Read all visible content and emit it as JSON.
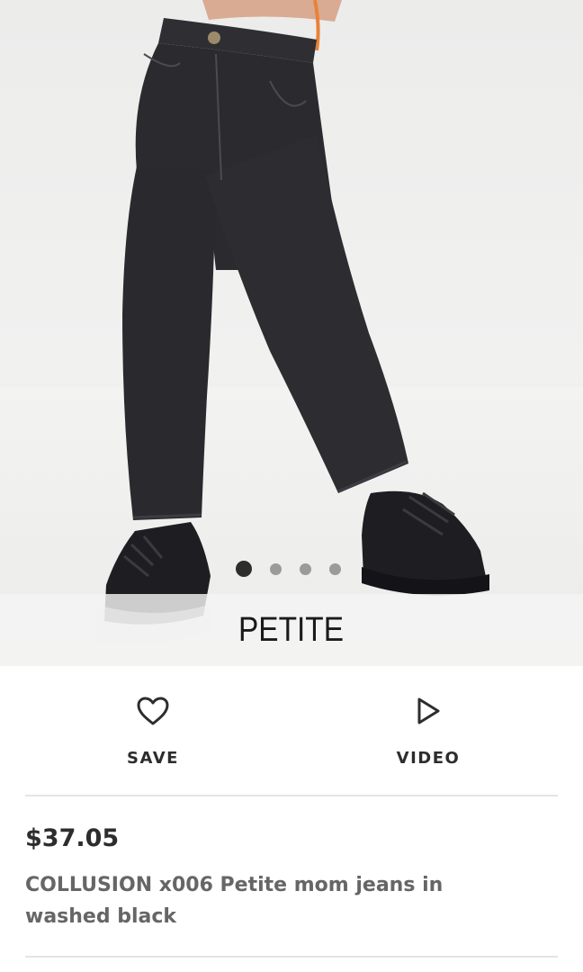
{
  "gallery": {
    "image_alt": "Model wearing washed black mom jeans with black chunky trainers",
    "dots_count": 4,
    "active_dot": 1,
    "banner_label": "PETITE"
  },
  "actions": {
    "save_label": "SAVE",
    "save_icon": "heart-outline-icon",
    "video_label": "VIDEO",
    "video_icon": "play-outline-icon"
  },
  "product": {
    "price": "$37.05",
    "title": "COLLUSION x006 Petite mom jeans in washed black"
  },
  "colors": {
    "text_dark": "#2d2d2d",
    "text_muted": "#666666",
    "divider": "#e4e4e4",
    "denim": "#2b2b2f"
  }
}
